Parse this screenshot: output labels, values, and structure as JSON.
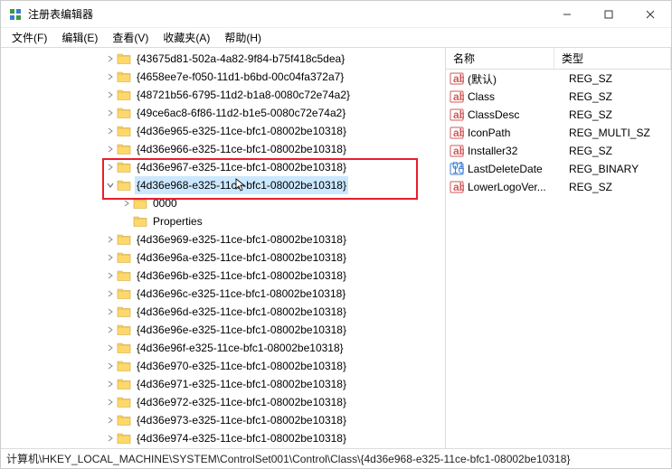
{
  "window": {
    "title": "注册表编辑器"
  },
  "menu": {
    "file": "文件(F)",
    "edit": "编辑(E)",
    "view": "查看(V)",
    "favorites": "收藏夹(A)",
    "help": "帮助(H)"
  },
  "tree": {
    "indent_base": 114,
    "items": [
      {
        "label": "{43675d81-502a-4a82-9f84-b75f418c5dea}",
        "depth": 0,
        "expander": "right"
      },
      {
        "label": "{4658ee7e-f050-11d1-b6bd-00c04fa372a7}",
        "depth": 0,
        "expander": "right"
      },
      {
        "label": "{48721b56-6795-11d2-b1a8-0080c72e74a2}",
        "depth": 0,
        "expander": "right"
      },
      {
        "label": "{49ce6ac8-6f86-11d2-b1e5-0080c72e74a2}",
        "depth": 0,
        "expander": "right"
      },
      {
        "label": "{4d36e965-e325-11ce-bfc1-08002be10318}",
        "depth": 0,
        "expander": "right"
      },
      {
        "label": "{4d36e966-e325-11ce-bfc1-08002be10318}",
        "depth": 0,
        "expander": "right"
      },
      {
        "label": "{4d36e967-e325-11ce-bfc1-08002be10318}",
        "depth": 0,
        "expander": "right"
      },
      {
        "label": "{4d36e968-e325-11ce-bfc1-08002be10318}",
        "depth": 0,
        "expander": "down",
        "selected": true,
        "highlighted": true,
        "cursor": true
      },
      {
        "label": "0000",
        "depth": 1,
        "expander": "right"
      },
      {
        "label": "Properties",
        "depth": 1,
        "expander": "none"
      },
      {
        "label": "{4d36e969-e325-11ce-bfc1-08002be10318}",
        "depth": 0,
        "expander": "right"
      },
      {
        "label": "{4d36e96a-e325-11ce-bfc1-08002be10318}",
        "depth": 0,
        "expander": "right"
      },
      {
        "label": "{4d36e96b-e325-11ce-bfc1-08002be10318}",
        "depth": 0,
        "expander": "right"
      },
      {
        "label": "{4d36e96c-e325-11ce-bfc1-08002be10318}",
        "depth": 0,
        "expander": "right"
      },
      {
        "label": "{4d36e96d-e325-11ce-bfc1-08002be10318}",
        "depth": 0,
        "expander": "right"
      },
      {
        "label": "{4d36e96e-e325-11ce-bfc1-08002be10318}",
        "depth": 0,
        "expander": "right"
      },
      {
        "label": "{4d36e96f-e325-11ce-bfc1-08002be10318}",
        "depth": 0,
        "expander": "right"
      },
      {
        "label": "{4d36e970-e325-11ce-bfc1-08002be10318}",
        "depth": 0,
        "expander": "right"
      },
      {
        "label": "{4d36e971-e325-11ce-bfc1-08002be10318}",
        "depth": 0,
        "expander": "right"
      },
      {
        "label": "{4d36e972-e325-11ce-bfc1-08002be10318}",
        "depth": 0,
        "expander": "right"
      },
      {
        "label": "{4d36e973-e325-11ce-bfc1-08002be10318}",
        "depth": 0,
        "expander": "right"
      },
      {
        "label": "{4d36e974-e325-11ce-bfc1-08002be10318}",
        "depth": 0,
        "expander": "right"
      }
    ]
  },
  "list": {
    "headers": {
      "name": "名称",
      "type": "类型"
    },
    "rows": [
      {
        "name": "(默认)",
        "type": "REG_SZ",
        "kind": "sz"
      },
      {
        "name": "Class",
        "type": "REG_SZ",
        "kind": "sz"
      },
      {
        "name": "ClassDesc",
        "type": "REG_SZ",
        "kind": "sz"
      },
      {
        "name": "IconPath",
        "type": "REG_MULTI_SZ",
        "kind": "sz"
      },
      {
        "name": "Installer32",
        "type": "REG_SZ",
        "kind": "sz"
      },
      {
        "name": "LastDeleteDate",
        "type": "REG_BINARY",
        "kind": "bin"
      },
      {
        "name": "LowerLogoVer...",
        "type": "REG_SZ",
        "kind": "sz"
      }
    ]
  },
  "status": {
    "path": "计算机\\HKEY_LOCAL_MACHINE\\SYSTEM\\ControlSet001\\Control\\Class\\{4d36e968-e325-11ce-bfc1-08002be10318}"
  }
}
